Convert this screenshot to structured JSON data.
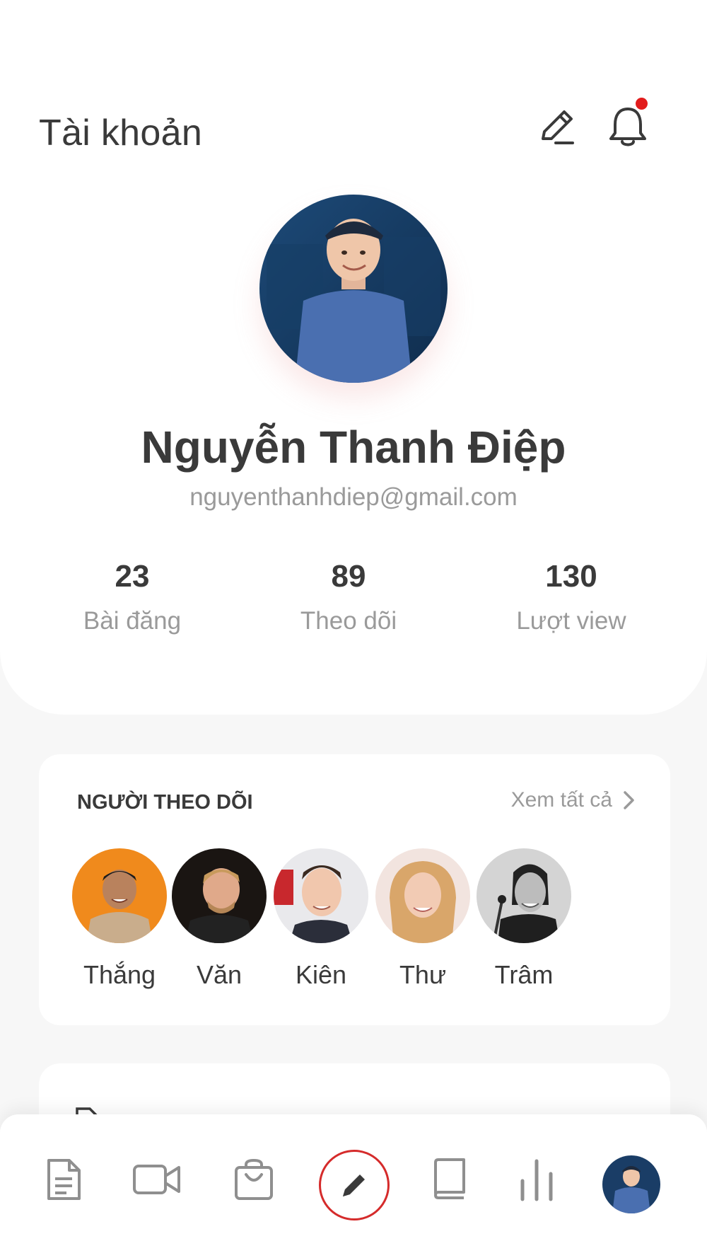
{
  "header": {
    "title": "Tài khoản",
    "edit_icon": "pencil-icon",
    "bell_icon": "bell-icon",
    "has_notification": true,
    "notification_color": "#e21c1c"
  },
  "profile": {
    "name": "Nguyễn Thanh Điệp",
    "email": "nguyenthanhdiep@gmail.com",
    "stats": [
      {
        "value": "23",
        "label": "Bài đăng"
      },
      {
        "value": "89",
        "label": "Theo dõi"
      },
      {
        "value": "130",
        "label": "Lượt view"
      }
    ]
  },
  "followers": {
    "title": "NGƯỜI THEO DÕI",
    "see_all": "Xem tất cả",
    "items": [
      {
        "name": "Thắng"
      },
      {
        "name": "Văn"
      },
      {
        "name": "Kiên"
      },
      {
        "name": "Thư"
      },
      {
        "name": "Trâm"
      }
    ]
  },
  "bottom_nav": {
    "items": [
      "document-icon",
      "video-icon",
      "shopping-bag-icon",
      "pencil-icon",
      "book-icon",
      "bar-chart-icon",
      "avatar"
    ],
    "active_color": "#d52b2b"
  },
  "colors": {
    "accent": "#d52b2b",
    "text_primary": "#3a3a3a",
    "text_secondary": "#9a9a9a",
    "background": "#f7f7f7"
  }
}
